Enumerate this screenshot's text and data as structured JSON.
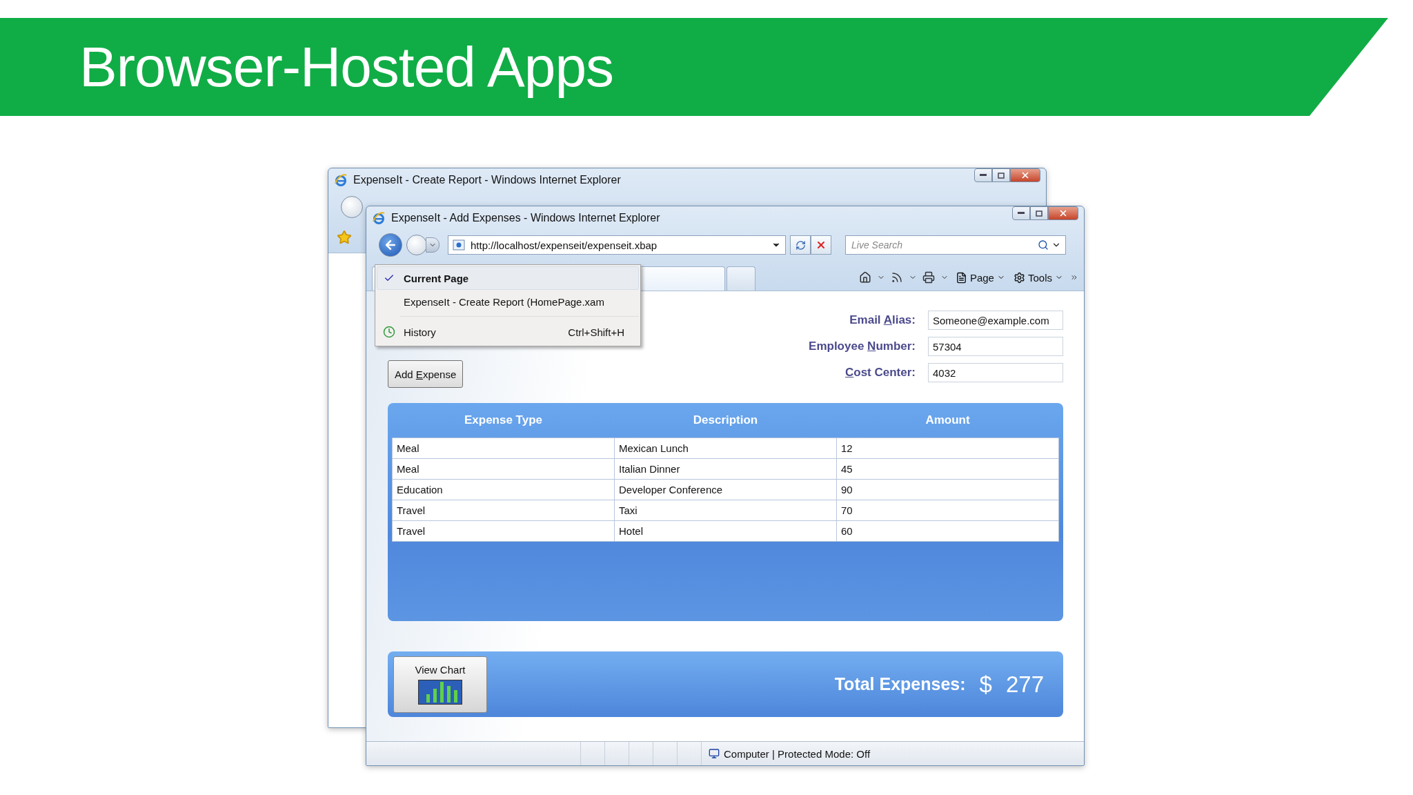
{
  "slide": {
    "title": "Browser-Hosted Apps"
  },
  "back_window": {
    "title": "ExpenseIt - Create Report - Windows Internet Explorer"
  },
  "front_window": {
    "title": "ExpenseIt - Add Expenses - Windows Internet Explorer",
    "address": "http://localhost/expenseit/expenseit.xbap",
    "search": {
      "placeholder": "Live Search"
    },
    "toolbar": {
      "page": "Page",
      "tools": "Tools"
    },
    "history_menu": [
      {
        "kind": "page",
        "label": "Current Page",
        "checked": true,
        "selected": true
      },
      {
        "kind": "page",
        "label": "ExpenseIt - Create Report (HomePage.xam",
        "checked": false,
        "selected": false
      },
      {
        "kind": "history",
        "label": "History",
        "shortcut": "Ctrl+Shift+H",
        "checked": false,
        "selected": false
      }
    ],
    "add_button": {
      "before": "Add ",
      "key": "E",
      "after": "xpense"
    },
    "form": [
      {
        "before": "Email ",
        "key": "A",
        "after": "lias:",
        "value": "Someone@example.com"
      },
      {
        "before": "Employee ",
        "key": "N",
        "after": "umber:",
        "value": "57304"
      },
      {
        "key": "C",
        "after": "ost Center:",
        "value": "4032"
      }
    ],
    "table": {
      "columns": [
        "Expense Type",
        "Description",
        "Amount"
      ],
      "rows": [
        [
          "Meal",
          "Mexican Lunch",
          "12"
        ],
        [
          "Meal",
          "Italian Dinner",
          "45"
        ],
        [
          "Education",
          "Developer Conference",
          "90"
        ],
        [
          "Travel",
          "Taxi",
          "70"
        ],
        [
          "Travel",
          "Hotel",
          "60"
        ]
      ]
    },
    "chart_button": "View Chart",
    "total": {
      "label": "Total Expenses:",
      "currency": "$",
      "value": "277"
    },
    "status": "Computer | Protected Mode: Off"
  }
}
